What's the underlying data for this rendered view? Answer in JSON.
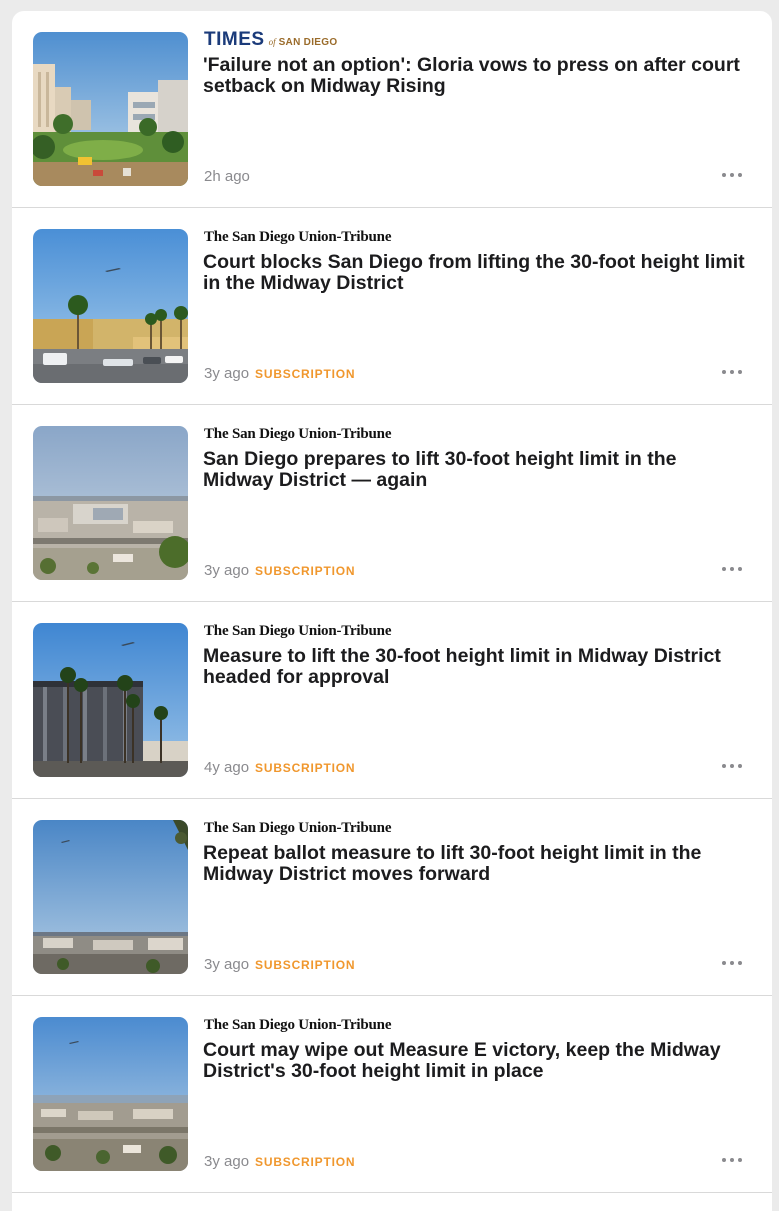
{
  "articles": [
    {
      "source": {
        "type": "times",
        "name_main": "TIMES",
        "name_of": "of",
        "name_city": "SAN DIEGO"
      },
      "headline": "'Failure not an option': Gloria vows to press on after court setback on Midway Rising",
      "age": "2h ago",
      "badge": "",
      "thumb": "rendering"
    },
    {
      "source": {
        "type": "ut",
        "name": "The San Diego Union-Tribune"
      },
      "headline": "Court blocks San Diego from lifting the 30-foot height limit in the Midway District",
      "age": "3y ago",
      "badge": "SUBSCRIPTION",
      "thumb": "palms-lot"
    },
    {
      "source": {
        "type": "ut",
        "name": "The San Diego Union-Tribune"
      },
      "headline": "San Diego prepares to lift 30-foot height limit in the Midway District — again",
      "age": "3y ago",
      "badge": "SUBSCRIPTION",
      "thumb": "cityscape"
    },
    {
      "source": {
        "type": "ut",
        "name": "The San Diego Union-Tribune"
      },
      "headline": "Measure to lift the 30-foot height limit in Midway District headed for approval",
      "age": "4y ago",
      "badge": "SUBSCRIPTION",
      "thumb": "arena-palms"
    },
    {
      "source": {
        "type": "ut",
        "name": "The San Diego Union-Tribune"
      },
      "headline": "Repeat ballot measure to lift 30-foot height limit in the Midway District moves forward",
      "age": "3y ago",
      "badge": "SUBSCRIPTION",
      "thumb": "sky-city"
    },
    {
      "source": {
        "type": "ut",
        "name": "The San Diego Union-Tribune"
      },
      "headline": "Court may wipe out Measure E victory, keep the Midway District's 30-foot height limit in place",
      "age": "3y ago",
      "badge": "SUBSCRIPTION",
      "thumb": "bay-view"
    }
  ],
  "colors": {
    "badge": "#f0972d",
    "meta": "#8a8a8e",
    "times_blue": "#1b3b7a"
  }
}
